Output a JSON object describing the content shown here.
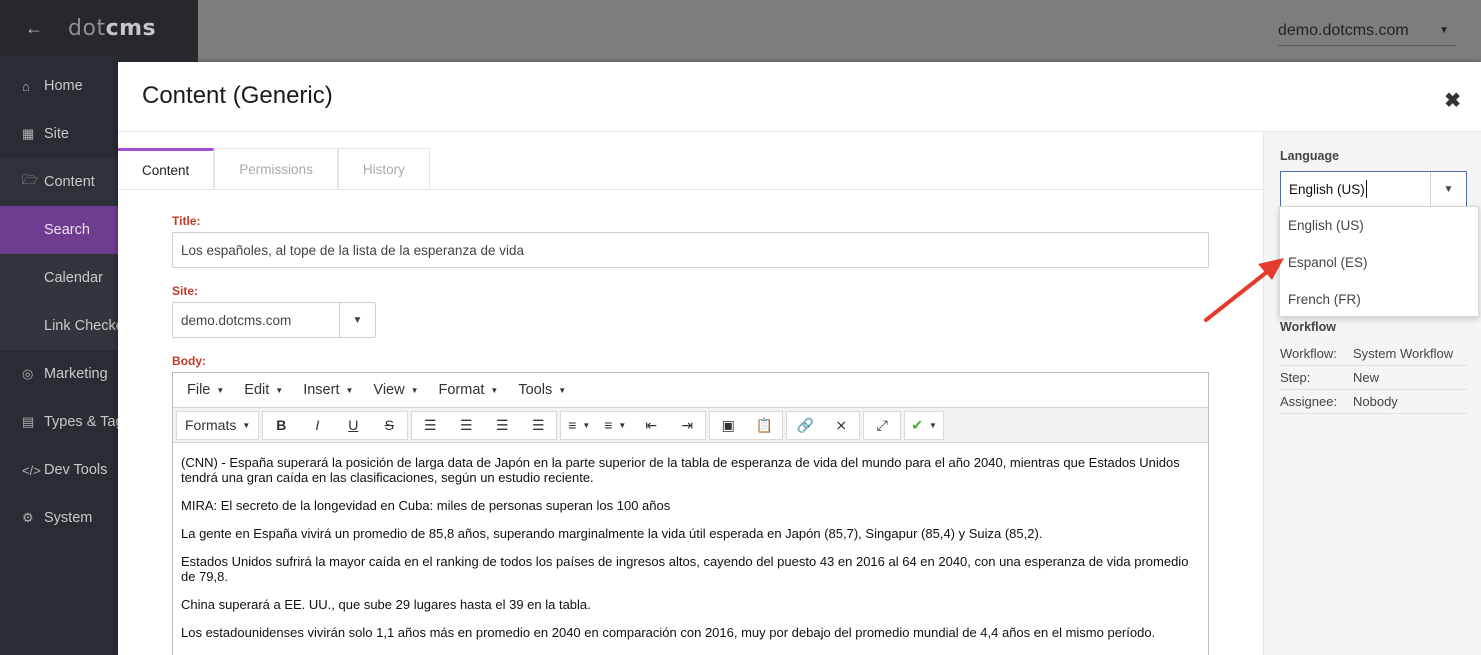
{
  "sidebar": {
    "logo": {
      "pre": "d",
      "dot": "o",
      "post": "t",
      "brand": "cms"
    },
    "items": [
      {
        "label": "Home",
        "icon": "home-icon"
      },
      {
        "label": "Site",
        "icon": "sitemap-icon"
      },
      {
        "label": "Content",
        "icon": "folder-open-icon"
      },
      {
        "label": "Marketing",
        "icon": "bullseye-icon"
      },
      {
        "label": "Types & Tags",
        "icon": "file-icon"
      },
      {
        "label": "Dev Tools",
        "icon": "code-icon"
      },
      {
        "label": "System",
        "icon": "gear-icon"
      }
    ],
    "content_sub": [
      {
        "label": "Search"
      },
      {
        "label": "Calendar"
      },
      {
        "label": "Link Checker"
      }
    ]
  },
  "topbar": {
    "site": "demo.dotcms.com"
  },
  "dialog": {
    "title": "Content (Generic)",
    "tabs": [
      {
        "label": "Content"
      },
      {
        "label": "Permissions"
      },
      {
        "label": "History"
      }
    ],
    "fields": {
      "title_label": "Title:",
      "title_value": "Los españoles, al tope de la lista de la esperanza de vida",
      "site_label": "Site:",
      "site_value": "demo.dotcms.com",
      "body_label": "Body:"
    },
    "editor": {
      "menus": [
        "File",
        "Edit",
        "Insert",
        "View",
        "Format",
        "Tools"
      ],
      "formats_label": "Formats",
      "paragraphs": [
        "(CNN) - España superará la posición de larga data de Japón en la parte superior de la tabla de esperanza de vida del mundo para el año 2040, mientras que Estados Unidos tendrá una gran caída en las clasificaciones, según un estudio reciente.",
        "MIRA: El secreto de la longevidad en Cuba: miles de personas superan los 100 años",
        "La gente en España vivirá un promedio de 85,8 años, superando marginalmente la vida útil esperada en Japón (85,7), Singapur (85,4) y Suiza (85,2).",
        "Estados Unidos sufrirá la mayor caída en el ranking de todos los países de ingresos altos, cayendo del puesto 43 en 2016 al 64 en 2040, con una esperanza de vida promedio de 79,8.",
        "China superará a EE. UU., que sube 29 lugares hasta el 39 en la tabla.",
        "Los estadounidenses vivirán solo 1,1 años más en promedio en 2040 en comparación con 2016, muy por debajo del promedio mundial de 4,4 años en el mismo período."
      ]
    }
  },
  "right_panel": {
    "language_label": "Language",
    "language_value": "English (US)",
    "language_options": [
      "English (US)",
      "Espanol (ES)",
      "French (FR)"
    ],
    "workflow_title": "Workflow",
    "workflow": [
      {
        "key": "Workflow:",
        "value": "System Workflow"
      },
      {
        "key": "Step:",
        "value": "New"
      },
      {
        "key": "Assignee:",
        "value": "Nobody"
      }
    ]
  },
  "colors": {
    "accent": "#a24fd6",
    "active_nav": "#6f3d8f",
    "required_label": "#c0392b",
    "arrow": "#e53b2c"
  }
}
